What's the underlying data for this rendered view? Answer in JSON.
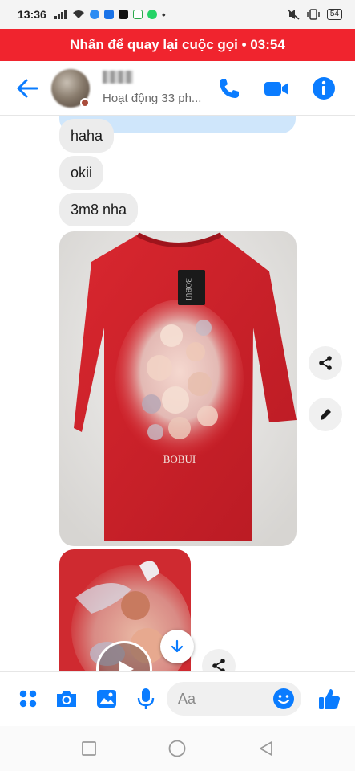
{
  "status_bar": {
    "time": "13:36",
    "battery": "54"
  },
  "call_banner": {
    "text": "Nhấn để quay lại cuộc gọi • 03:54"
  },
  "header": {
    "status": "Hoạt động 33 ph..."
  },
  "messages": [
    {
      "text": "haha"
    },
    {
      "text": "okii"
    },
    {
      "text": "3m8 nha"
    }
  ],
  "tshirt_print": {
    "brand": "BOBUI"
  },
  "composer": {
    "placeholder": "Aa"
  },
  "colors": {
    "accent": "#0a7cff",
    "banner": "#f0242e",
    "shirt": "#d1232b"
  }
}
